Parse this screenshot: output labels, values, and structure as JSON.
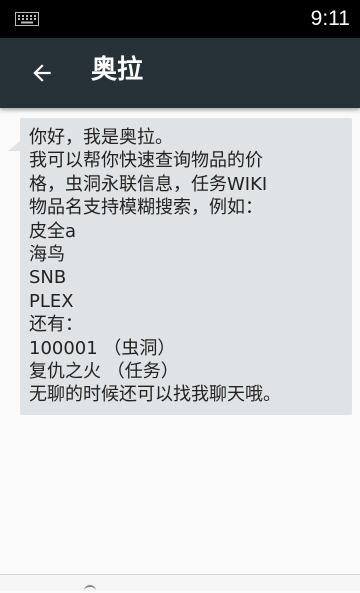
{
  "status_bar": {
    "time": "9:11",
    "keyboard_icon": "keyboard-icon"
  },
  "app_bar": {
    "title": "奥拉",
    "back_icon": "arrow-back-icon",
    "background": "#263238"
  },
  "message": {
    "bubble_color": "#dfe3e6",
    "lines": [
      "你好，我是奥拉。",
      "我可以帮你快速查询物品的价",
      "格，虫洞永联信息，任务WIKI",
      "物品名支持模糊搜索，例如：",
      "皮全a",
      "海鸟",
      "SNB",
      "PLEX",
      "还有：",
      "100001 （虫洞）",
      "复仇之火 （任务）",
      "无聊的时候还可以找我聊天哦。"
    ]
  }
}
